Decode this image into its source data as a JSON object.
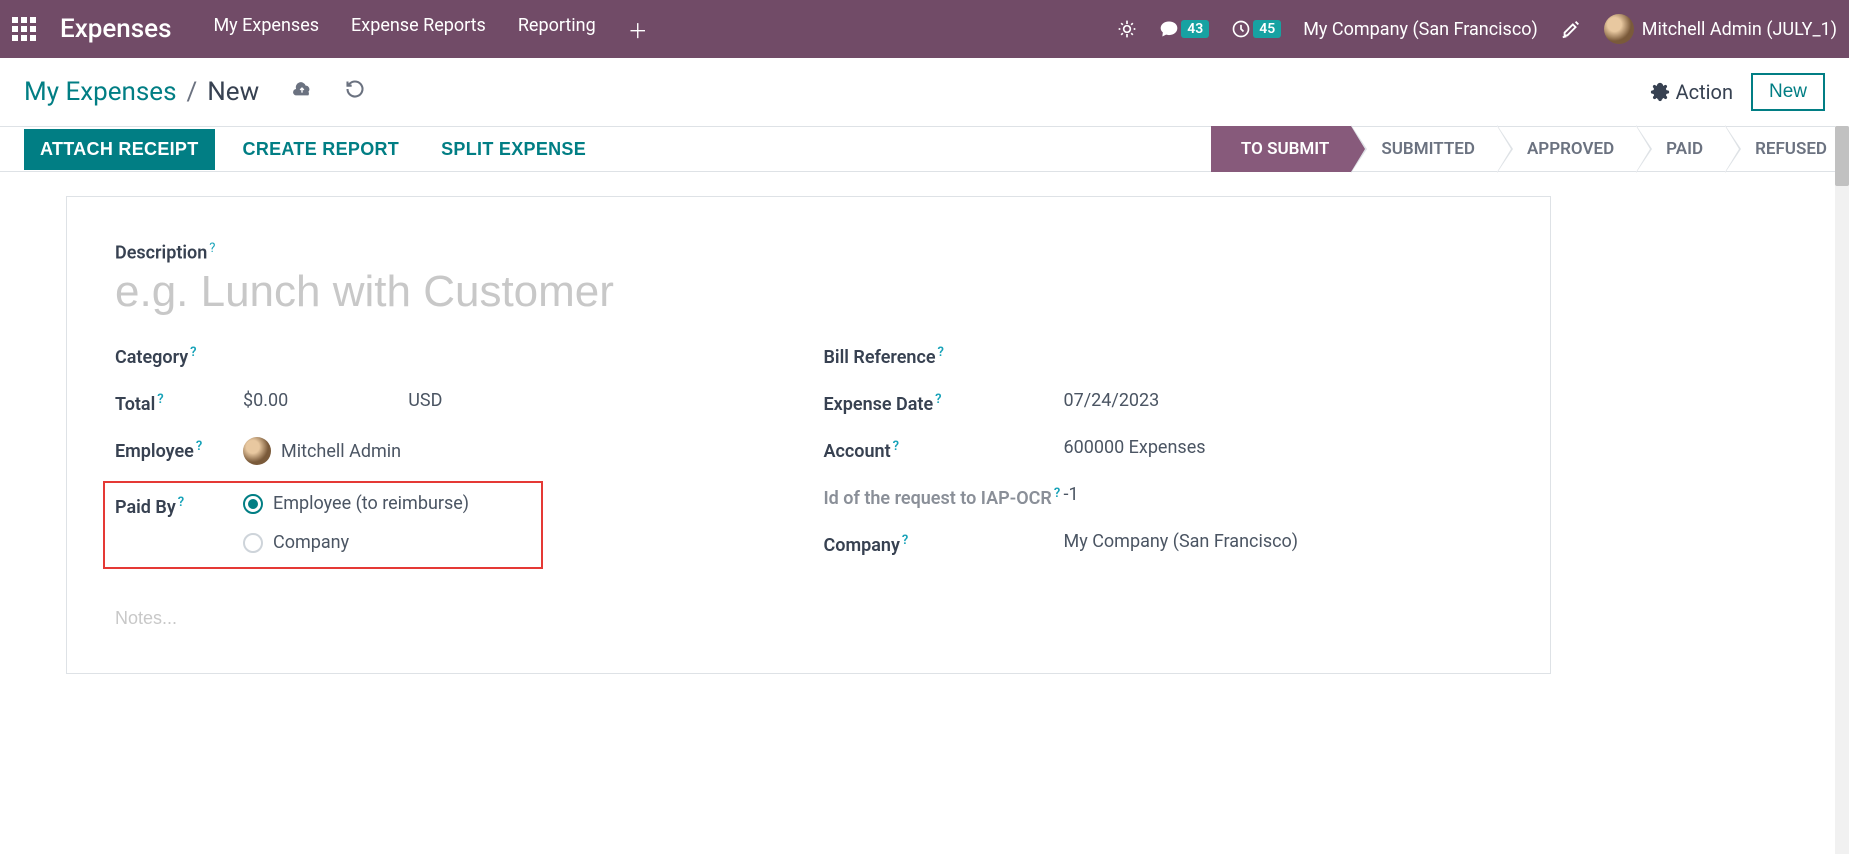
{
  "navbar": {
    "brand": "Expenses",
    "menu": [
      "My Expenses",
      "Expense Reports",
      "Reporting"
    ],
    "messages_badge": "43",
    "activities_badge": "45",
    "company": "My Company (San Francisco)",
    "user": "Mitchell Admin (JULY_1)"
  },
  "breadcrumb": {
    "back": "My Expenses",
    "current": "New",
    "action_label": "Action",
    "new_label": "New"
  },
  "actions": {
    "attach": "ATTACH RECEIPT",
    "create": "CREATE REPORT",
    "split": "SPLIT EXPENSE"
  },
  "status_steps": [
    "TO SUBMIT",
    "SUBMITTED",
    "APPROVED",
    "PAID",
    "REFUSED"
  ],
  "form": {
    "description_label": "Description",
    "description_placeholder": "e.g. Lunch with Customer",
    "category_label": "Category",
    "total_label": "Total",
    "total_value": "$0.00",
    "currency": "USD",
    "employee_label": "Employee",
    "employee_value": "Mitchell Admin",
    "paid_by_label": "Paid By",
    "paid_by_options": {
      "employee": "Employee (to reimburse)",
      "company": "Company"
    },
    "bill_ref_label": "Bill Reference",
    "expense_date_label": "Expense Date",
    "expense_date_value": "07/24/2023",
    "account_label": "Account",
    "account_value": "600000 Expenses",
    "iap_label": "Id of the request to IAP-OCR",
    "iap_value": "-1",
    "company_label": "Company",
    "company_value": "My Company (San Francisco)",
    "notes_placeholder": "Notes..."
  }
}
